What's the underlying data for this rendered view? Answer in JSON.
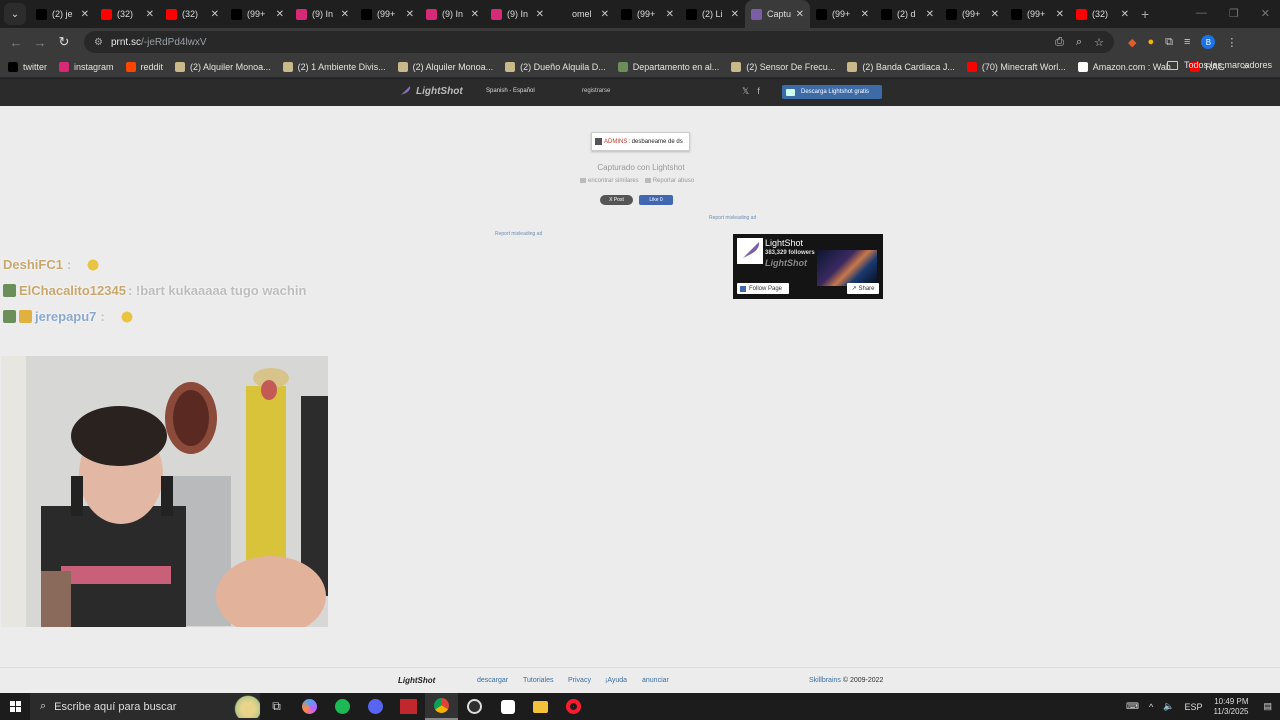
{
  "tabs": [
    {
      "title": "(2) je",
      "fav": "x",
      "color": "#000000"
    },
    {
      "title": "(32)",
      "fav": "yt",
      "color": "#ff0000"
    },
    {
      "title": "(32)",
      "fav": "yt",
      "color": "#ff0000"
    },
    {
      "title": "(99+",
      "fav": "tt",
      "color": "#000000"
    },
    {
      "title": "(9) In",
      "fav": "ig",
      "color": "#d62976"
    },
    {
      "title": "(99+",
      "fav": "tt",
      "color": "#000000"
    },
    {
      "title": "(9) In",
      "fav": "ig",
      "color": "#d62976"
    },
    {
      "title": "(9) In",
      "fav": "ig",
      "color": "#d62976"
    },
    {
      "title": "omel",
      "fav": "om",
      "color": "#1f1f1f"
    },
    {
      "title": "(99+",
      "fav": "tt",
      "color": "#000000"
    },
    {
      "title": "(2) Li",
      "fav": "x",
      "color": "#000000"
    },
    {
      "title": "Captu",
      "fav": "ls",
      "color": "#7b5ea7",
      "active": true
    },
    {
      "title": "(99+",
      "fav": "tt",
      "color": "#000000"
    },
    {
      "title": "(2) d",
      "fav": "x",
      "color": "#000000"
    },
    {
      "title": "(99+",
      "fav": "tt",
      "color": "#000000"
    },
    {
      "title": "(99+",
      "fav": "tt",
      "color": "#000000"
    },
    {
      "title": "(32)",
      "fav": "yt",
      "color": "#ff0000"
    }
  ],
  "toolbar": {
    "url_domain": "prnt.sc",
    "url_path": "/-jeRdPd4lwxV"
  },
  "bookmarks": [
    {
      "label": "twitter",
      "color": "#000000"
    },
    {
      "label": "instagram",
      "color": "#d62976"
    },
    {
      "label": "reddit",
      "color": "#ff4500"
    },
    {
      "label": "(2) Alquiler Monoa...",
      "color": "#c9b88a"
    },
    {
      "label": "(2) 1 Ambiente Divis...",
      "color": "#c9b88a"
    },
    {
      "label": "(2) Alquiler Monoa...",
      "color": "#c9b88a"
    },
    {
      "label": "(2) Dueño Alquila D...",
      "color": "#c9b88a"
    },
    {
      "label": "Departamento en al...",
      "color": "#6b8e5a"
    },
    {
      "label": "(2) Sensor De Frecu...",
      "color": "#c9b88a"
    },
    {
      "label": "(2) Banda Cardiaca J...",
      "color": "#c9b88a"
    },
    {
      "label": "(70) Minecraft Worl...",
      "color": "#ff0000"
    },
    {
      "label": "Amazon.com : Wah...",
      "color": "#ffffff"
    },
    {
      "label": "RAG",
      "color": "#ff0000"
    }
  ],
  "bookmarks_all": "Todos los marcadores",
  "lightshot": {
    "logo": "LightShot",
    "lang": "Spanish - Español",
    "register": "registrarse",
    "download": "Descarga Lightshot gratis",
    "caption_red": "ADMINS",
    "caption_text": ": desbaneame de ds",
    "captured": "Capturado con Lightshot",
    "find_similar": "encontrar similares",
    "report_abuse": "Reportar abuso",
    "x_post": "X Post",
    "fb_like": "Like 0",
    "report_ad": "Report misleading ad",
    "fb_page_name": "LightShot",
    "fb_followers": "383,329 followers",
    "fb_follow": "Follow Page",
    "fb_share": "Share"
  },
  "chat": [
    {
      "user": "DeshiFC1",
      "sep": ":",
      "msg": "",
      "emote": true,
      "badges": 0,
      "color": "gold"
    },
    {
      "user": "ElChacalito12345",
      "sep": "",
      "msg": ": !bart kukaaaaa tugo wachin",
      "emote": false,
      "badges": 1,
      "color": "gold"
    },
    {
      "user": "jerepapu7",
      "sep": ":",
      "msg": "",
      "emote": true,
      "badges": 2,
      "color": "blue"
    }
  ],
  "footer": {
    "logo": "LightShot",
    "links": [
      "descargar",
      "Tutoriales",
      "Privacy",
      "¡Ayuda",
      "anunciar"
    ],
    "copy_brand": "Skillbrains",
    "copy_rest": " © 2009-2022"
  },
  "taskbar": {
    "search_placeholder": "Escribe aquí para buscar",
    "lang": "ESP",
    "time": "10:49 PM",
    "date": "11/3/2025"
  }
}
